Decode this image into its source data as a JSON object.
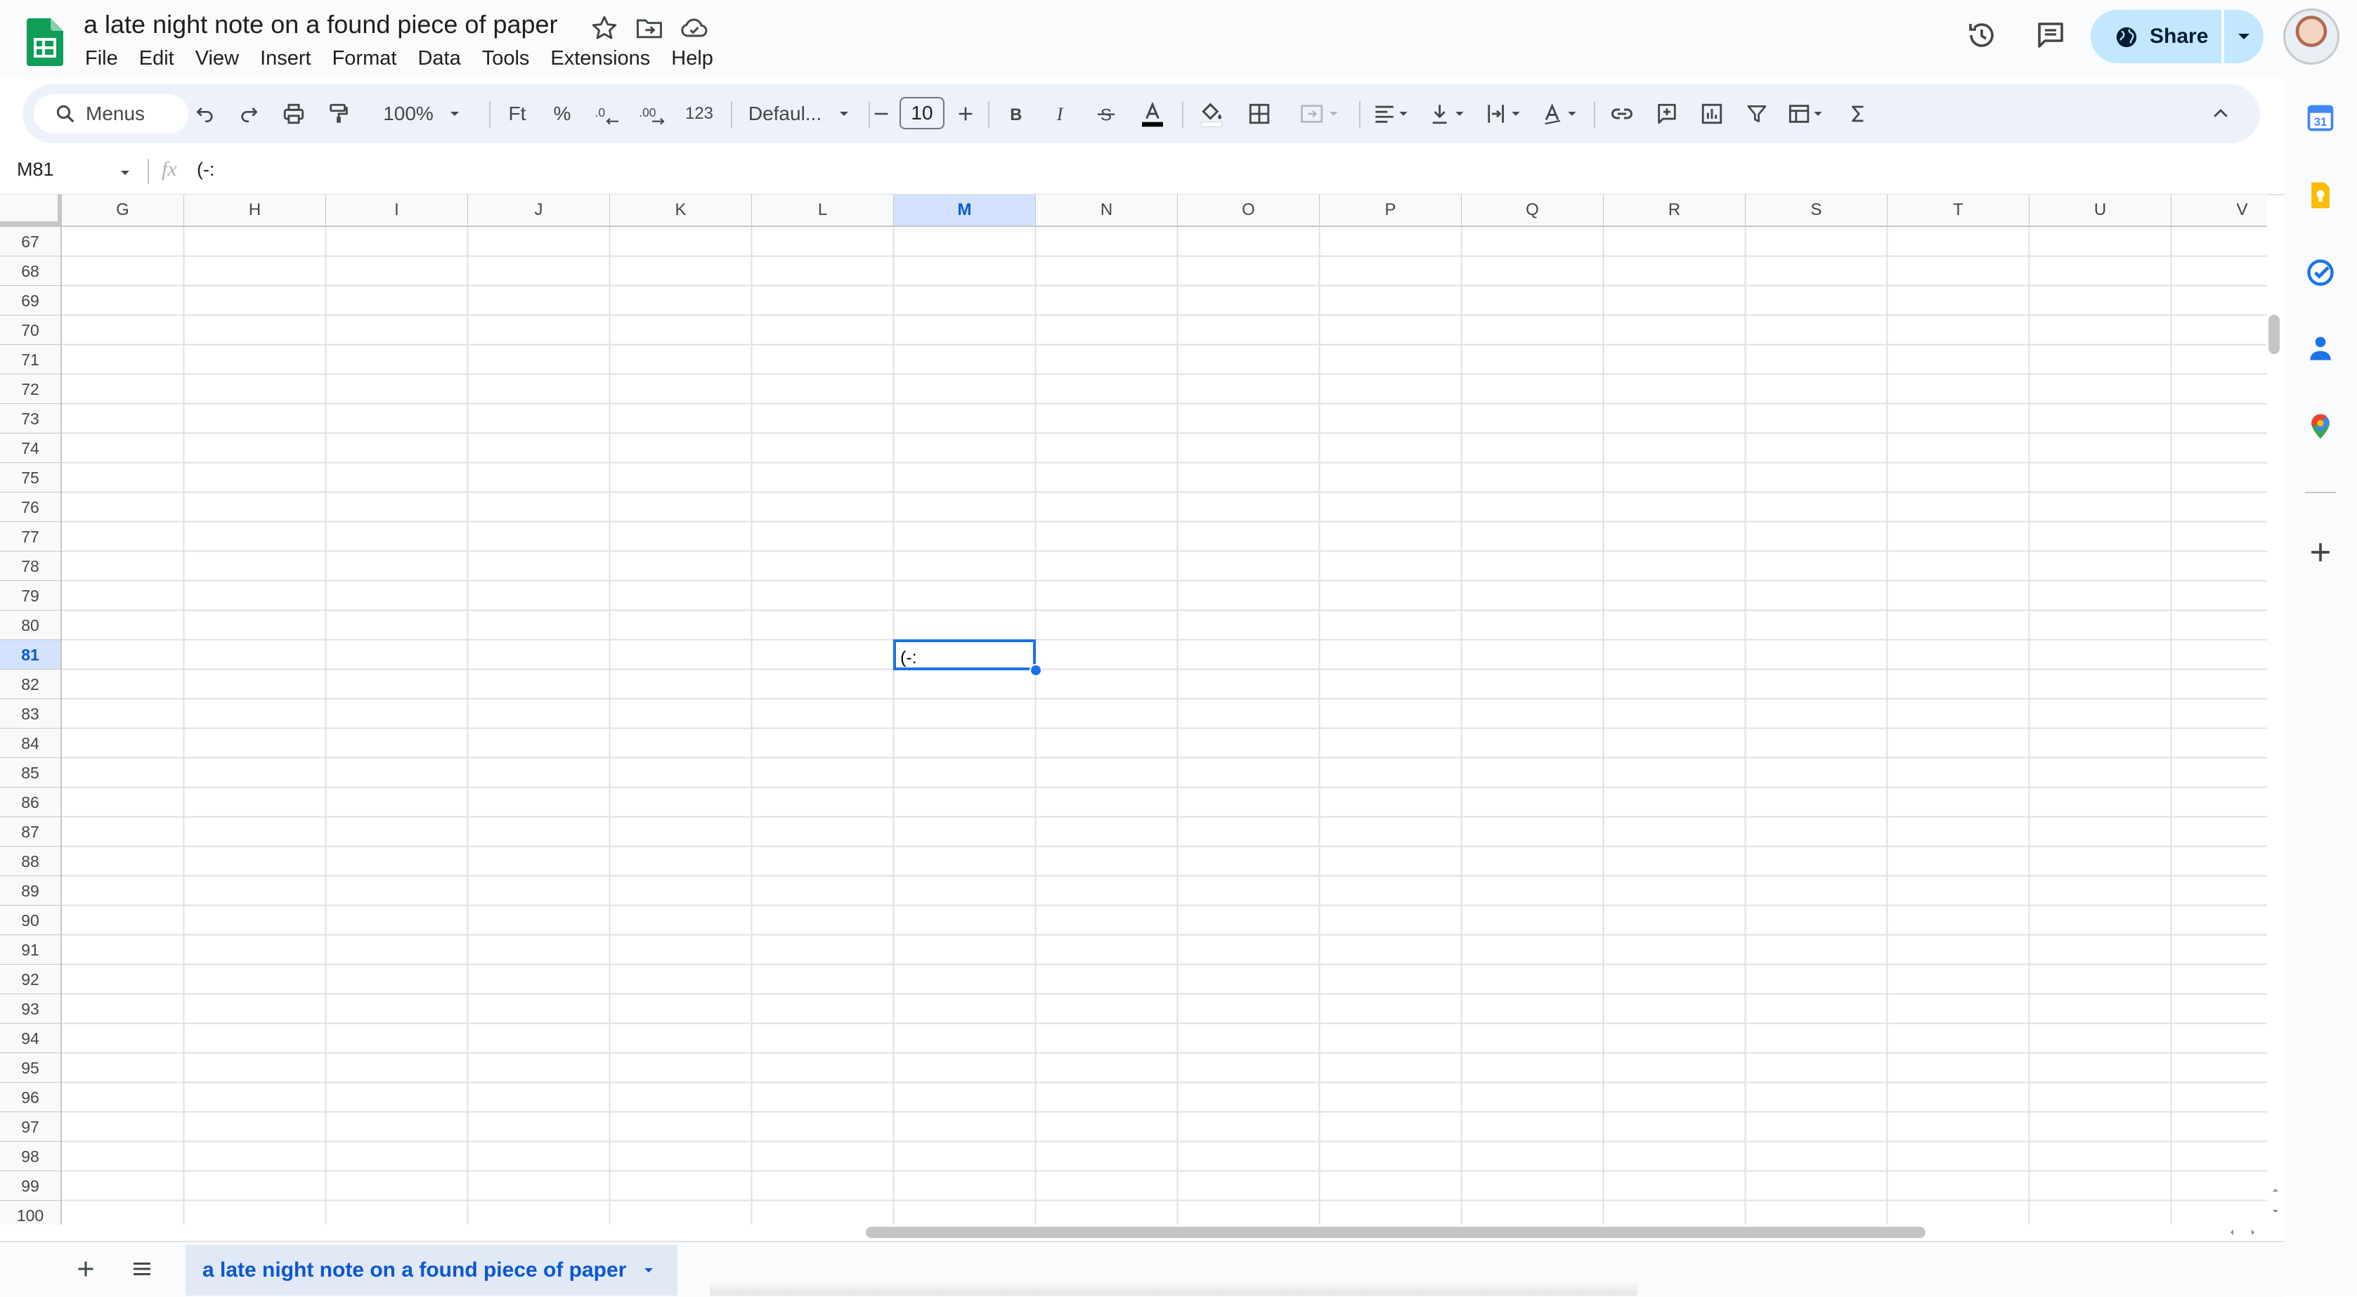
{
  "document": {
    "title": "a late night note on a found piece of paper"
  },
  "menu": [
    "File",
    "Edit",
    "View",
    "Insert",
    "Format",
    "Data",
    "Tools",
    "Extensions",
    "Help"
  ],
  "share": {
    "label": "Share"
  },
  "toolbar": {
    "search_label": "Menus",
    "zoom": "100%",
    "currency_format": "Ft",
    "percent_format": "%",
    "more_formats": "123",
    "font_family": "Defaul...",
    "font_size": "10"
  },
  "formula_bar": {
    "name_box": "M81",
    "fx_label": "fx",
    "content": "(-:"
  },
  "grid": {
    "columns": [
      "G",
      "H",
      "I",
      "J",
      "K",
      "L",
      "M",
      "N",
      "O",
      "P",
      "Q",
      "R",
      "S",
      "T",
      "U",
      "V"
    ],
    "rows": [
      67,
      68,
      69,
      70,
      71,
      72,
      73,
      74,
      75,
      76,
      77,
      78,
      79,
      80,
      81,
      82,
      83,
      84,
      85,
      86,
      87,
      88,
      89,
      90,
      91,
      92,
      93,
      94,
      95,
      96,
      97,
      98,
      99,
      100
    ],
    "selected_column": "M",
    "selected_row": 81,
    "active_cell_value": "(-:"
  },
  "sheets": {
    "active_tab": "a late night note on a found piece of paper"
  },
  "colors": {
    "accent": "#1a73e8",
    "share_bg": "#c2e7ff",
    "sheets_green": "#0f9d58",
    "toolbar_bg": "#edf2fa",
    "selection_header": "#d3e3fd"
  }
}
